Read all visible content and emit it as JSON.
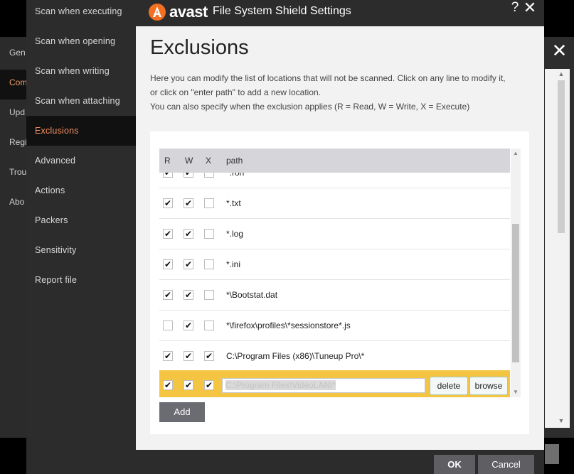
{
  "background": {
    "nav_items": [
      "Gen",
      "Com",
      "Upd",
      "Regi",
      "Trou",
      "Abo"
    ],
    "active_index": 1
  },
  "nav": {
    "items": [
      "Scan when executing",
      "Scan when opening",
      "Scan when writing",
      "Scan when attaching",
      "Exclusions",
      "Advanced",
      "Actions",
      "Packers",
      "Sensitivity",
      "Report file"
    ],
    "active": "Exclusions"
  },
  "title": {
    "brand": "avast",
    "text": "File System Shield Settings",
    "help": "?",
    "close": "✕"
  },
  "content": {
    "heading": "Exclusions",
    "desc_line1": "Here you can modify the list of locations that will not be scanned. Click on any line to modify it,",
    "desc_line2": "or click on \"enter path\" to add a new location.",
    "desc_line3": "You can also specify when the exclusion applies (R = Read, W = Write, X = Execute)"
  },
  "grid": {
    "headers": {
      "r": "R",
      "w": "W",
      "x": "X",
      "path": "path"
    },
    "rows": [
      {
        "r": true,
        "w": true,
        "x": false,
        "path": "*.ron"
      },
      {
        "r": true,
        "w": true,
        "x": false,
        "path": "*.txt"
      },
      {
        "r": true,
        "w": true,
        "x": false,
        "path": "*.log"
      },
      {
        "r": true,
        "w": true,
        "x": false,
        "path": "*.ini"
      },
      {
        "r": true,
        "w": true,
        "x": false,
        "path": "*\\Bootstat.dat"
      },
      {
        "r": false,
        "w": true,
        "x": false,
        "path": "*\\firefox\\profiles\\*sessionstore*.js"
      },
      {
        "r": true,
        "w": true,
        "x": true,
        "path": "C:\\Program Files (x86)\\Tuneup Pro\\*"
      }
    ],
    "editing_row": {
      "r": true,
      "w": true,
      "x": true,
      "value": "C:\\Program Files\\VideoLAN\\*",
      "delete_label": "delete",
      "browse_label": "browse"
    },
    "check_glyph": "✔",
    "add_label": "Add"
  },
  "footer": {
    "ok_label": "OK",
    "cancel_label": "Cancel"
  },
  "colors": {
    "accent": "#f19060",
    "brand_orange": "#f36f21",
    "selected_row": "#f4c542",
    "dark_bg": "#2c2c2c"
  }
}
